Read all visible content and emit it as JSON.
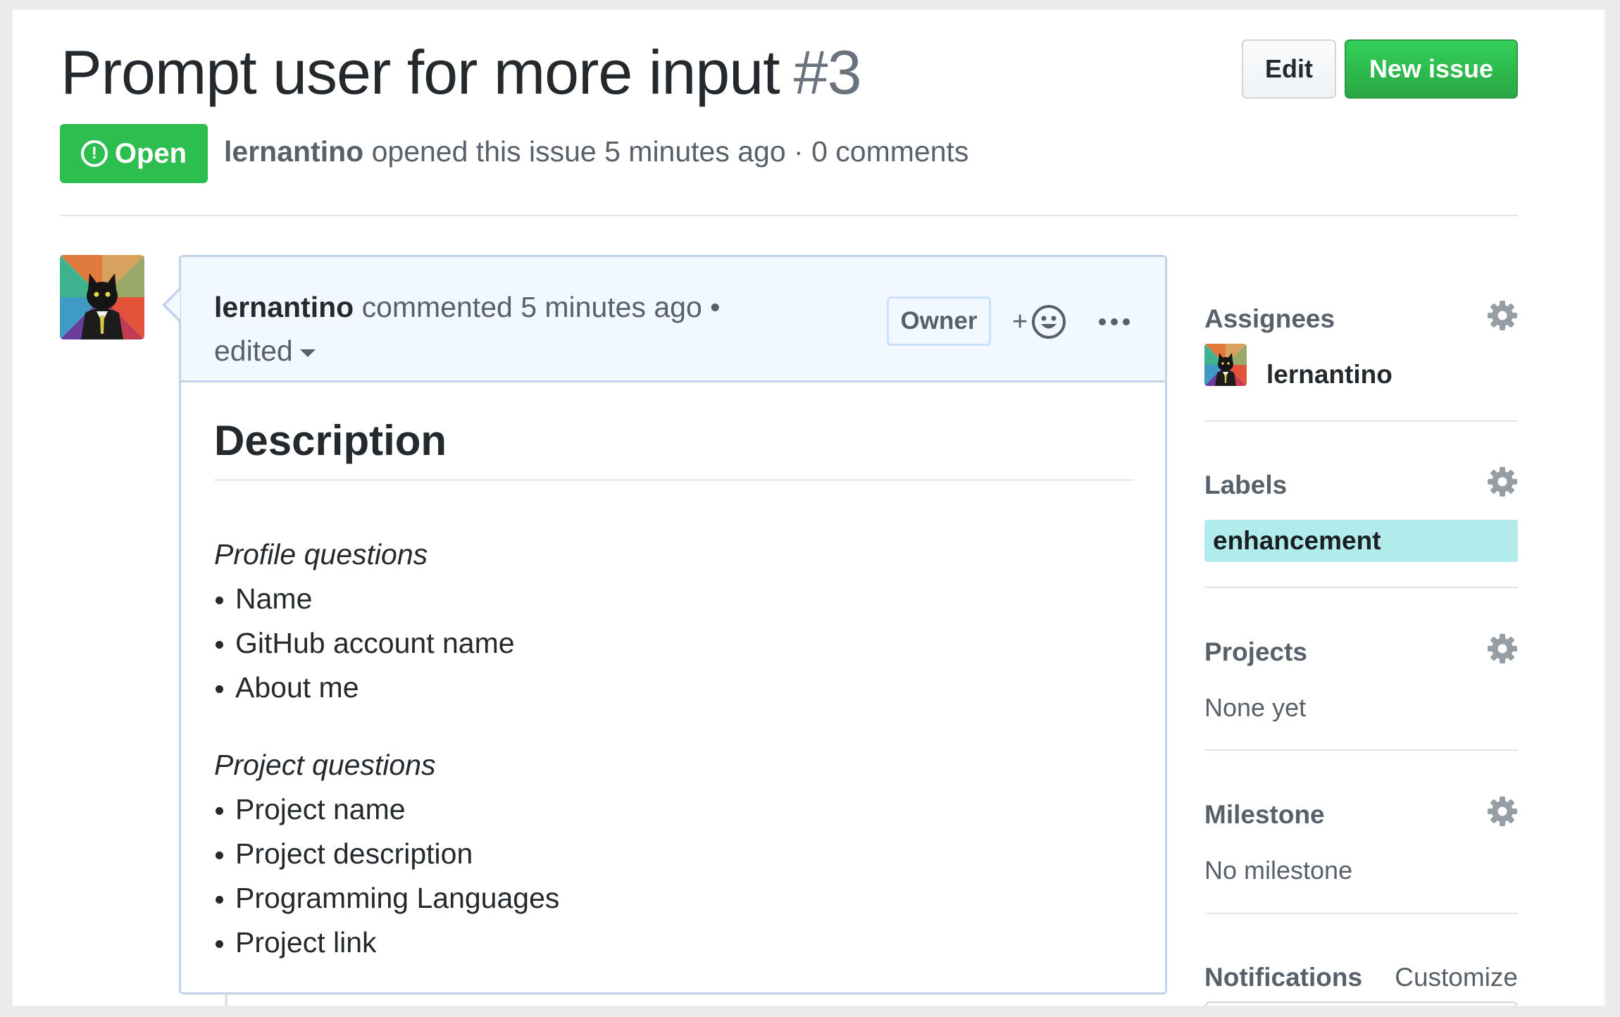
{
  "issue": {
    "title": "Prompt user for more input",
    "number": "#3",
    "state": "Open",
    "author": "lernantino",
    "meta_rest": "opened this issue 5 minutes ago · 0 comments"
  },
  "header_buttons": {
    "edit_label": "Edit",
    "new_issue_label": "New issue"
  },
  "comment": {
    "author": "lernantino",
    "action": "commented 5 minutes ago •",
    "edited": "edited",
    "badge": "Owner",
    "reaction_plus": "+",
    "heading": "Description",
    "sections": [
      {
        "title": "Profile questions",
        "items": [
          "Name",
          "GitHub account name",
          "About me"
        ]
      },
      {
        "title": "Project questions",
        "items": [
          "Project name",
          "Project description",
          "Programming Languages",
          "Project link"
        ]
      }
    ]
  },
  "sidebar": {
    "assignees": {
      "heading": "Assignees",
      "name": "lernantino"
    },
    "labels": {
      "heading": "Labels",
      "label": "enhancement",
      "label_color": "#b1ebec"
    },
    "projects": {
      "heading": "Projects",
      "value": "None yet"
    },
    "milestone": {
      "heading": "Milestone",
      "value": "No milestone"
    },
    "notifications": {
      "heading": "Notifications",
      "action": "Customize"
    }
  },
  "colors": {
    "open_green": "#2cbe4e",
    "new_issue_green": "#28a745",
    "comment_header_bg": "#f1f8ff",
    "comment_border": "#c0d3eb"
  }
}
